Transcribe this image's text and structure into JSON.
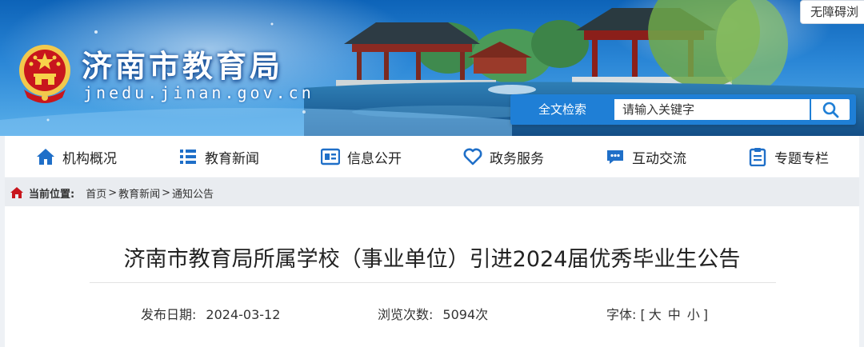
{
  "header": {
    "site_title": "济南市教育局",
    "site_domain": "jnedu.jinan.gov.cn",
    "accessibility_link": "无障碍浏",
    "search": {
      "label": "全文检索",
      "placeholder": "请输入关键字"
    }
  },
  "nav": {
    "items": [
      {
        "label": "机构概况",
        "icon": "home-icon"
      },
      {
        "label": "教育新闻",
        "icon": "list-icon"
      },
      {
        "label": "信息公开",
        "icon": "document-icon"
      },
      {
        "label": "政务服务",
        "icon": "heart-icon"
      },
      {
        "label": "互动交流",
        "icon": "chat-icon"
      },
      {
        "label": "专题专栏",
        "icon": "clipboard-icon"
      }
    ]
  },
  "breadcrumb": {
    "prefix": "当前位置:",
    "items": [
      "首页",
      "教育新闻",
      "通知公告"
    ],
    "separator": ">"
  },
  "article": {
    "title": "济南市教育局所属学校（事业单位）引进2024届优秀毕业生公告",
    "publish_label": "发布日期:",
    "publish_date": "2024-03-12",
    "views_label": "浏览次数:",
    "views_value": "5094次",
    "font_label": "字体:",
    "font_open": "[",
    "font_sizes": [
      "大",
      "中",
      "小"
    ],
    "font_close": "]"
  },
  "colors": {
    "brand_blue": "#1f7fd6",
    "nav_icon_blue": "#1f6fc8",
    "banner_dark": "#0d63b8"
  }
}
